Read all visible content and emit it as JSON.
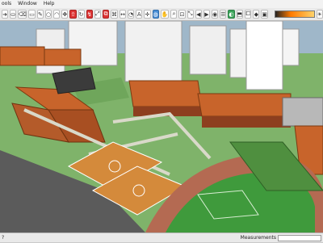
{
  "menu": [
    "ools",
    "Window",
    "Help"
  ],
  "toolbar_icons": [
    "select-icon",
    "paint-bucket-icon",
    "eraser-icon",
    "rectangle-icon",
    "pencil-icon",
    "circle-icon",
    "arc-icon",
    "move-icon",
    "push-pull-icon",
    "rotate-icon",
    "follow-me-icon",
    "scale-icon",
    "offset-icon",
    "tape-measure-icon",
    "dimension-icon",
    "protractor-icon",
    "text-icon",
    "axes-icon",
    "3d-text-icon",
    "orbit-icon",
    "pan-icon",
    "zoom-icon",
    "zoom-window-icon",
    "zoom-extents-icon",
    "previous-view-icon",
    "next-view-icon",
    "position-camera-icon",
    "walk-icon",
    "look-around-icon",
    "section-plane-icon",
    "components-icon",
    "materials-icon",
    "styles-icon",
    "layers-icon",
    "scenes-icon",
    "shadow-settings-icon"
  ],
  "status": {
    "left": "?",
    "measurements_label": "Measurements"
  },
  "scene": {
    "sky_color": "#9fb7c9",
    "ground_color": "#7fb36a",
    "roof_color": "#c8642b",
    "court_color": "#d48a3b",
    "track_color": "#b46a52",
    "field_color": "#3f9a3c"
  }
}
